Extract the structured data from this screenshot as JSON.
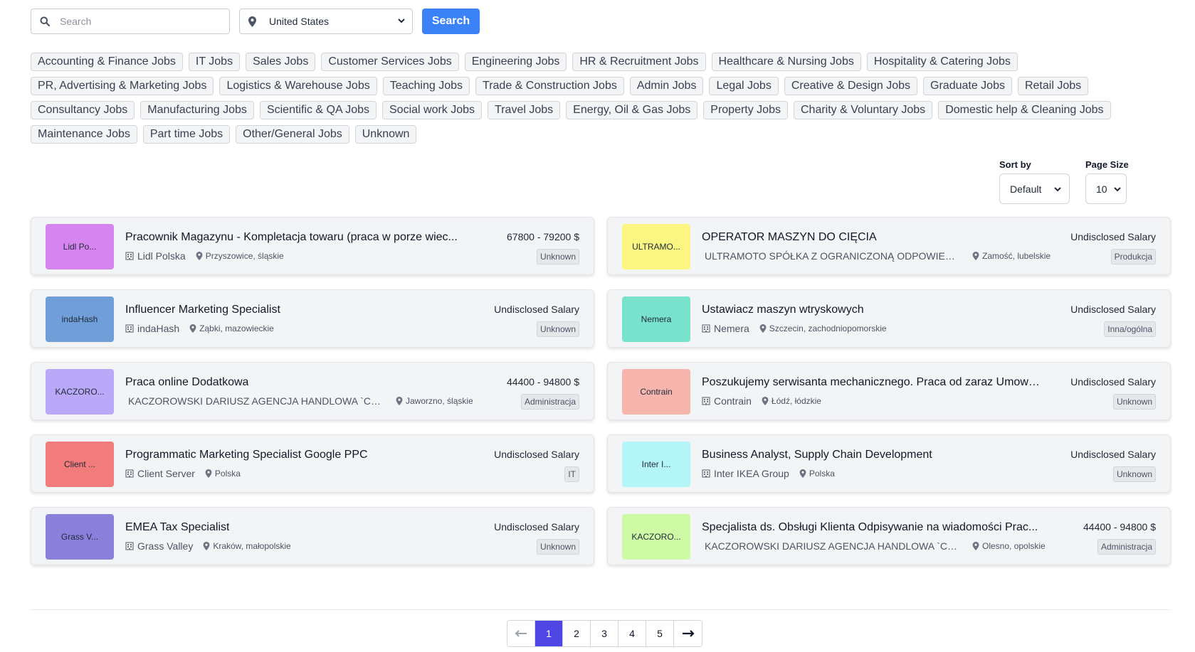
{
  "search": {
    "placeholder": "Search",
    "value": ""
  },
  "country": {
    "selected": "United States"
  },
  "search_button": "Search",
  "categories": [
    "Accounting & Finance Jobs",
    "IT Jobs",
    "Sales Jobs",
    "Customer Services Jobs",
    "Engineering Jobs",
    "HR & Recruitment Jobs",
    "Healthcare & Nursing Jobs",
    "Hospitality & Catering Jobs",
    "PR, Advertising & Marketing Jobs",
    "Logistics & Warehouse Jobs",
    "Teaching Jobs",
    "Trade & Construction Jobs",
    "Admin Jobs",
    "Legal Jobs",
    "Creative & Design Jobs",
    "Graduate Jobs",
    "Retail Jobs",
    "Consultancy Jobs",
    "Manufacturing Jobs",
    "Scientific & QA Jobs",
    "Social work Jobs",
    "Travel Jobs",
    "Energy, Oil & Gas Jobs",
    "Property Jobs",
    "Charity & Voluntary Jobs",
    "Domestic help & Cleaning Jobs",
    "Maintenance Jobs",
    "Part time Jobs",
    "Other/General Jobs",
    "Unknown"
  ],
  "sort": {
    "label": "Sort by",
    "value": "Default"
  },
  "page_size": {
    "label": "Page Size",
    "value": "10"
  },
  "jobs": [
    {
      "logo_text": "Lidl Po...",
      "logo_color": "#d584f0",
      "title": "Pracownik Magazynu - Kompletacja towaru (praca w porze wiec...",
      "company": "Lidl Polska",
      "location": "Przyszowice, śląskie",
      "salary": "67800 - 79200 $",
      "tag": "Unknown"
    },
    {
      "logo_text": "ULTRAMO...",
      "logo_color": "#fbf582",
      "title": "OPERATOR MASZYN DO CIĘCIA",
      "company": "ULTRAMOTO SPÓŁKA Z OGRANICZONĄ ODPOWIEDZIALN",
      "location": "Zamość, lubelskie",
      "salary": "Undisclosed Salary",
      "tag": "Produkcja"
    },
    {
      "logo_text": "indaHash",
      "logo_color": "#6f9ed8",
      "title": "Influencer Marketing Specialist",
      "company": "indaHash",
      "location": "Ząbki, mazowieckie",
      "salary": "Undisclosed Salary",
      "tag": "Unknown"
    },
    {
      "logo_text": "Nemera",
      "logo_color": "#79e2cc",
      "title": "Ustawiacz maszyn wtryskowych",
      "company": "Nemera",
      "location": "Szczecin, zachodniopomorskie",
      "salary": "Undisclosed Salary",
      "tag": "Inna/ogólna"
    },
    {
      "logo_text": "KACZORO...",
      "logo_color": "#b9a9f8",
      "title": "Praca online Dodatkowa",
      "company": "KACZOROWSKI DARIUSZ AGENCJA HANDLOWA `CARLOS`",
      "location": "Jaworzno, śląskie",
      "salary": "44400 - 94800 $",
      "tag": "Administracja"
    },
    {
      "logo_text": "Contrain",
      "logo_color": "#f6b5ad",
      "title": "Poszukujemy serwisanta mechanicznego. Praca od zaraz Umowa...",
      "company": "Contrain",
      "location": "Łódź, łódzkie",
      "salary": "Undisclosed Salary",
      "tag": "Unknown"
    },
    {
      "logo_text": "Client ...",
      "logo_color": "#f27b7b",
      "title": "Programmatic Marketing Specialist Google PPC",
      "company": "Client Server",
      "location": "Polska",
      "salary": "Undisclosed Salary",
      "tag": "IT"
    },
    {
      "logo_text": "Inter I...",
      "logo_color": "#b4f5f7",
      "title": "Business Analyst, Supply Chain Development",
      "company": "Inter IKEA Group",
      "location": "Polska",
      "salary": "Undisclosed Salary",
      "tag": "Unknown"
    },
    {
      "logo_text": "Grass V...",
      "logo_color": "#8b7fdc",
      "title": "EMEA Tax Specialist",
      "company": "Grass Valley",
      "location": "Kraków, małopolskie",
      "salary": "Undisclosed Salary",
      "tag": "Unknown"
    },
    {
      "logo_text": "KACZORO...",
      "logo_color": "#cefaa6",
      "title": "Specjalista ds. Obsługi Klienta Odpisywanie na wiadomości Prac...",
      "company": "KACZOROWSKI DARIUSZ AGENCJA HANDLOWA `CARLOS`",
      "location": "Olesno, opolskie",
      "salary": "44400 - 94800 $",
      "tag": "Administracja"
    }
  ],
  "pagination": {
    "pages": [
      "1",
      "2",
      "3",
      "4",
      "5"
    ],
    "current": "1"
  },
  "icons": {
    "search": "search-icon",
    "location": "map-pin-icon",
    "company": "building-icon",
    "prev": "arrow-left-icon",
    "next": "arrow-right-icon"
  },
  "colors": {
    "primary": "#3b82f6",
    "active_page": "#4f46e5"
  }
}
